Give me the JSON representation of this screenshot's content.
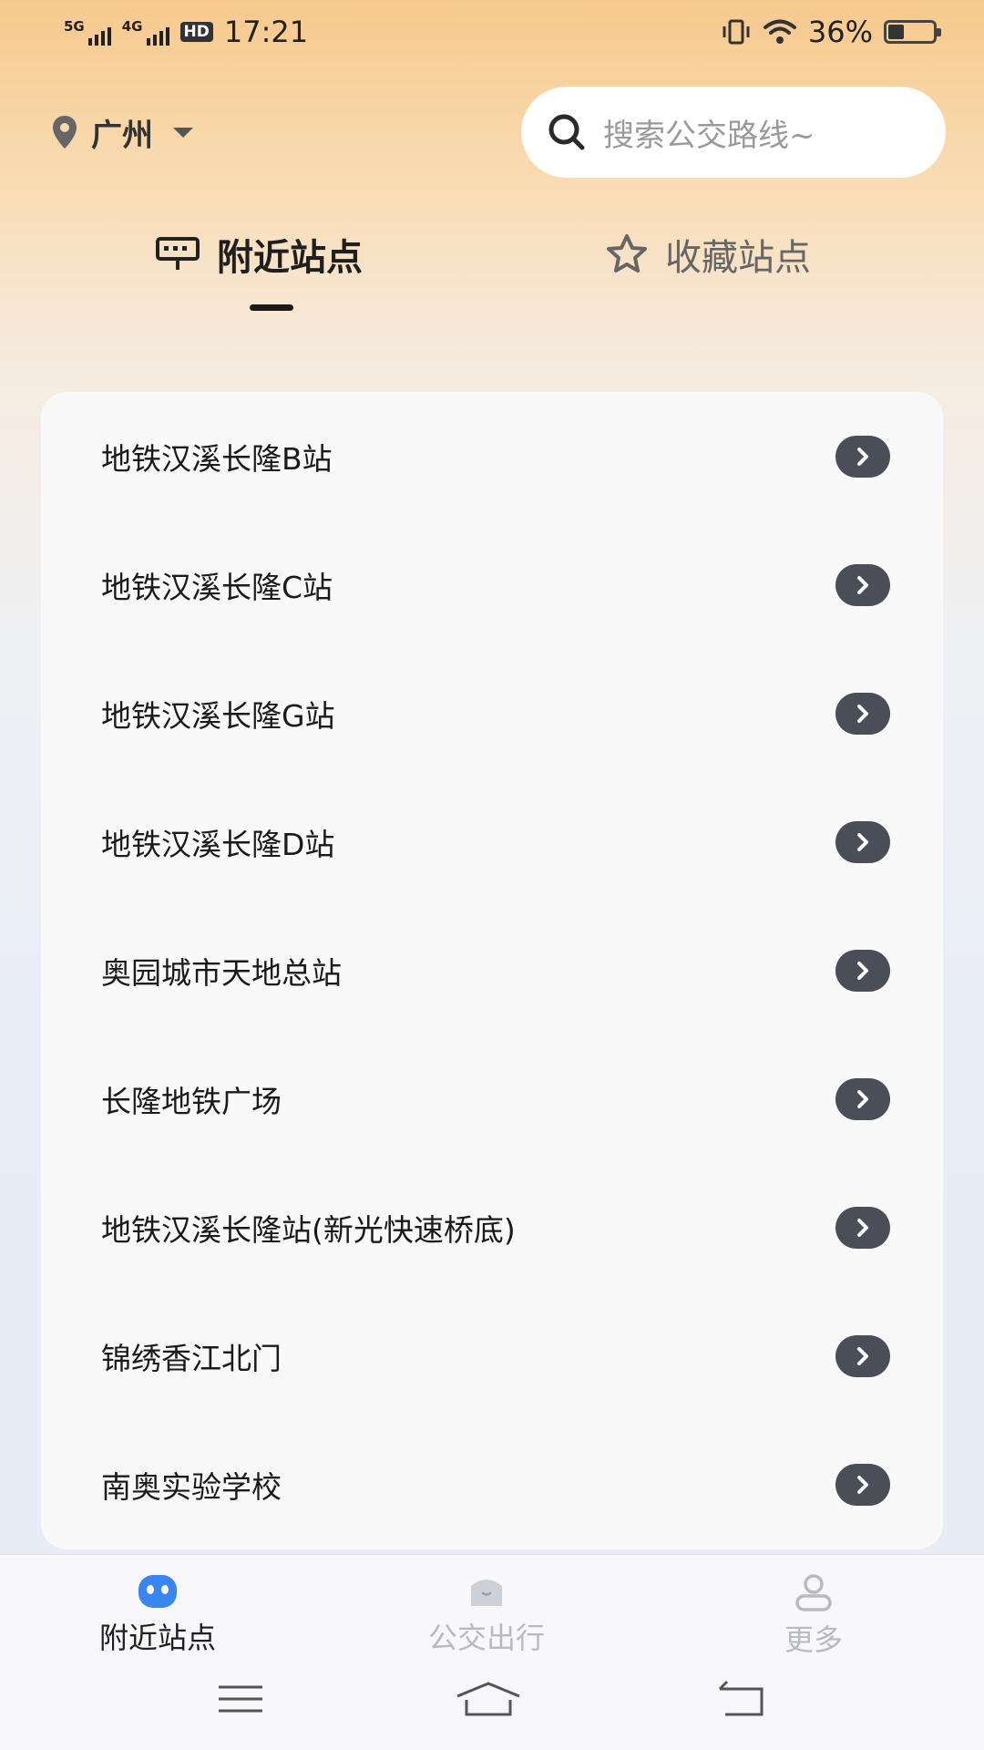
{
  "status_bar": {
    "network1": "5G",
    "network2": "4G",
    "hd": "HD",
    "time": "17:21",
    "battery": "36%",
    "battery_level": 0.36
  },
  "header": {
    "city": "广州",
    "search_placeholder": "搜索公交路线~"
  },
  "tabs": {
    "nearby": "附近站点",
    "favorites": "收藏站点"
  },
  "stations": [
    "地铁汉溪长隆B站",
    "地铁汉溪长隆C站",
    "地铁汉溪长隆G站",
    "地铁汉溪长隆D站",
    "奥园城市天地总站",
    "长隆地铁广场",
    "地铁汉溪长隆站(新光快速桥底)",
    "锦绣香江北门",
    "南奥实验学校"
  ],
  "bottom_nav": {
    "items": [
      "附近站点",
      "公交出行",
      "更多"
    ]
  },
  "colors": {
    "accent": "#3a86f0",
    "arrow_button": "#4a4e58"
  }
}
